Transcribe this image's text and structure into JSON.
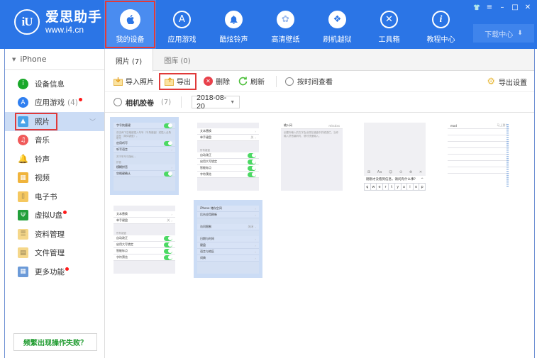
{
  "app": {
    "logo_mark": "iU",
    "title": "爱思助手",
    "url": "www.i4.cn"
  },
  "nav": [
    {
      "label": "我的设备",
      "icon": "apple-icon",
      "glyph": "",
      "active": true
    },
    {
      "label": "应用游戏",
      "icon": "app-store-icon",
      "glyph": "A",
      "active": false
    },
    {
      "label": "酷炫铃声",
      "icon": "bell-icon",
      "glyph": "🔔",
      "active": false
    },
    {
      "label": "高清壁纸",
      "icon": "flower-icon",
      "glyph": "✿",
      "active": false
    },
    {
      "label": "刷机越狱",
      "icon": "dropbox-icon",
      "glyph": "❖",
      "active": false
    },
    {
      "label": "工具箱",
      "icon": "tools-icon",
      "glyph": "✕",
      "active": false
    },
    {
      "label": "教程中心",
      "icon": "info-icon",
      "glyph": "i",
      "active": false
    }
  ],
  "window_controls": {
    "skin": "👕",
    "menu": "≡",
    "minimize": "–",
    "maximize": "□",
    "close": "✕"
  },
  "download_center": {
    "label": "下载中心",
    "icon": "⬇"
  },
  "device": {
    "name": "iPhone",
    "toggle": "▼"
  },
  "sidebar": {
    "items": [
      {
        "label": "设备信息",
        "icon": "info-green-icon",
        "color": "#1aa82a",
        "glyph": "i",
        "count": "",
        "dot": false
      },
      {
        "label": "应用游戏",
        "icon": "app-store-icon",
        "color": "#2f7ff0",
        "glyph": "A",
        "count": "(4)",
        "dot": true
      },
      {
        "label": "照片",
        "icon": "photo-icon",
        "color": "#4aa3e8",
        "glyph": "▲",
        "count": "",
        "dot": false,
        "active": true
      },
      {
        "label": "音乐",
        "icon": "music-icon",
        "color": "#f05a5a",
        "glyph": "♫",
        "count": "",
        "dot": false
      },
      {
        "label": "铃声",
        "icon": "bell-icon",
        "color": "#2f7ff0",
        "glyph": "🔔",
        "count": "",
        "dot": false
      },
      {
        "label": "视频",
        "icon": "film-icon",
        "color": "#f0b43c",
        "glyph": "▦",
        "count": "",
        "dot": false
      },
      {
        "label": "电子书",
        "icon": "book-icon",
        "color": "#f5c860",
        "glyph": "▯",
        "count": "",
        "dot": false
      },
      {
        "label": "虚拟U盘",
        "icon": "usb-icon",
        "color": "#22a03a",
        "glyph": "Ψ",
        "count": "",
        "dot": true
      },
      {
        "label": "资料管理",
        "icon": "contacts-icon",
        "color": "#f5d78a",
        "glyph": "☰",
        "count": "",
        "dot": false
      },
      {
        "label": "文件管理",
        "icon": "file-icon",
        "color": "#f5d78a",
        "glyph": "▤",
        "count": "",
        "dot": false
      },
      {
        "label": "更多功能",
        "icon": "more-apps-icon",
        "color": "#6b9ad8",
        "glyph": "▦",
        "count": "",
        "dot": true
      }
    ],
    "chevron": "﹀",
    "fail_button": "频繁出现操作失败？"
  },
  "tabs": [
    {
      "label": "照片 (7)",
      "active": true
    },
    {
      "label": "图库 (0)",
      "active": false
    }
  ],
  "toolbar": {
    "import_label": "导入照片",
    "export_label": "导出",
    "delete_label": "删除",
    "refresh_label": "刷新",
    "by_time_label": "按时间查看",
    "export_settings_label": "导出设置"
  },
  "filter": {
    "album_label": "相机胶卷",
    "album_count": "(7)",
    "date_value": "2018-08-20"
  },
  "photos": {
    "p1": {
      "selected": true,
      "rows": [
        {
          "type": "row",
          "text": "字号快捷键",
          "toggle": true
        },
        {
          "type": "cap",
          "text": "双击两下空格键插入句号（半角键盘）或插入全角逗号（简体键盘）。"
        },
        {
          "type": "cap",
          "text": "听写"
        },
        {
          "type": "row",
          "text": "启用听写",
          "toggle": true
        },
        {
          "type": "row",
          "text": "听写语言",
          "arrow": true
        },
        {
          "type": "cap",
          "text": "关于听写与隐私…"
        },
        {
          "type": "cap",
          "text": "拼音"
        },
        {
          "type": "row",
          "text": "模糊拼音",
          "arrow": true
        },
        {
          "type": "row",
          "text": "空格键确认",
          "toggle": true
        }
      ]
    },
    "p2": {
      "selected": false,
      "rows": [
        {
          "type": "gap"
        },
        {
          "type": "row",
          "text": "文本替换",
          "arrow": true
        },
        {
          "type": "row",
          "text": "单手键盘",
          "value": "关",
          "arrow": true
        },
        {
          "type": "gap"
        },
        {
          "type": "cap",
          "text": "所有键盘"
        },
        {
          "type": "row",
          "text": "自动改正",
          "toggle": true
        },
        {
          "type": "row",
          "text": "启用大写锁定",
          "toggle": true
        },
        {
          "type": "row",
          "text": "智能标点",
          "toggle": true
        },
        {
          "type": "row",
          "text": "字符预览",
          "toggle": true
        }
      ]
    },
    "p3": {
      "selected": false,
      "rows": [
        {
          "type": "row",
          "text": "输入码",
          "value": "mksdxx"
        },
        {
          "type": "cap",
          "text": "创建你输入的文字会出现在键盘中的候选栏，当你输入拼音编码时，便可快速输入。"
        }
      ]
    },
    "p4": {
      "selected": false,
      "kb_tools": [
        "⊞",
        "Aa",
        "☺",
        "⊙",
        "⊗",
        "✕"
      ],
      "kb_suggestion": "刚刚才没看到信息，请问有什么事?",
      "kb_keys": [
        "q",
        "w",
        "e",
        "r",
        "t",
        "y",
        "u",
        "i",
        "o",
        "p"
      ]
    },
    "p5": {
      "selected": false,
      "rows": [
        {
          "type": "row",
          "text": "mxd",
          "value": "马上到!"
        },
        {
          "type": "row",
          "text": ""
        },
        {
          "type": "row",
          "text": ""
        },
        {
          "type": "row",
          "text": ""
        },
        {
          "type": "row",
          "text": ""
        },
        {
          "type": "row",
          "text": ""
        },
        {
          "type": "row",
          "text": ""
        },
        {
          "type": "row",
          "text": ""
        }
      ]
    },
    "p6": {
      "selected": false,
      "rows": [
        {
          "type": "gap"
        },
        {
          "type": "row",
          "text": "文本替换",
          "arrow": true
        },
        {
          "type": "row",
          "text": "单手键盘",
          "value": "关",
          "arrow": true
        },
        {
          "type": "gap"
        },
        {
          "type": "cap",
          "text": "所有键盘"
        },
        {
          "type": "row",
          "text": "自动改正",
          "toggle": true
        },
        {
          "type": "row",
          "text": "启用大写锁定",
          "toggle": true
        },
        {
          "type": "row",
          "text": "智能标点",
          "toggle": true
        },
        {
          "type": "row",
          "text": "字符预览",
          "toggle": true
        }
      ]
    },
    "p7": {
      "selected": true,
      "rows": [
        {
          "type": "row",
          "text": "iPhone 储存空间",
          "arrow": true
        },
        {
          "type": "row",
          "text": "后台应用刷新",
          "arrow": true
        },
        {
          "type": "gap"
        },
        {
          "type": "row",
          "text": "访问限制",
          "value": "关闭",
          "arrow": true
        },
        {
          "type": "gap"
        },
        {
          "type": "row",
          "text": "日期与时间",
          "arrow": true
        },
        {
          "type": "row",
          "text": "键盘",
          "arrow": true
        },
        {
          "type": "row",
          "text": "语言与地区",
          "arrow": true
        },
        {
          "type": "row",
          "text": "词典",
          "arrow": true
        }
      ]
    }
  }
}
